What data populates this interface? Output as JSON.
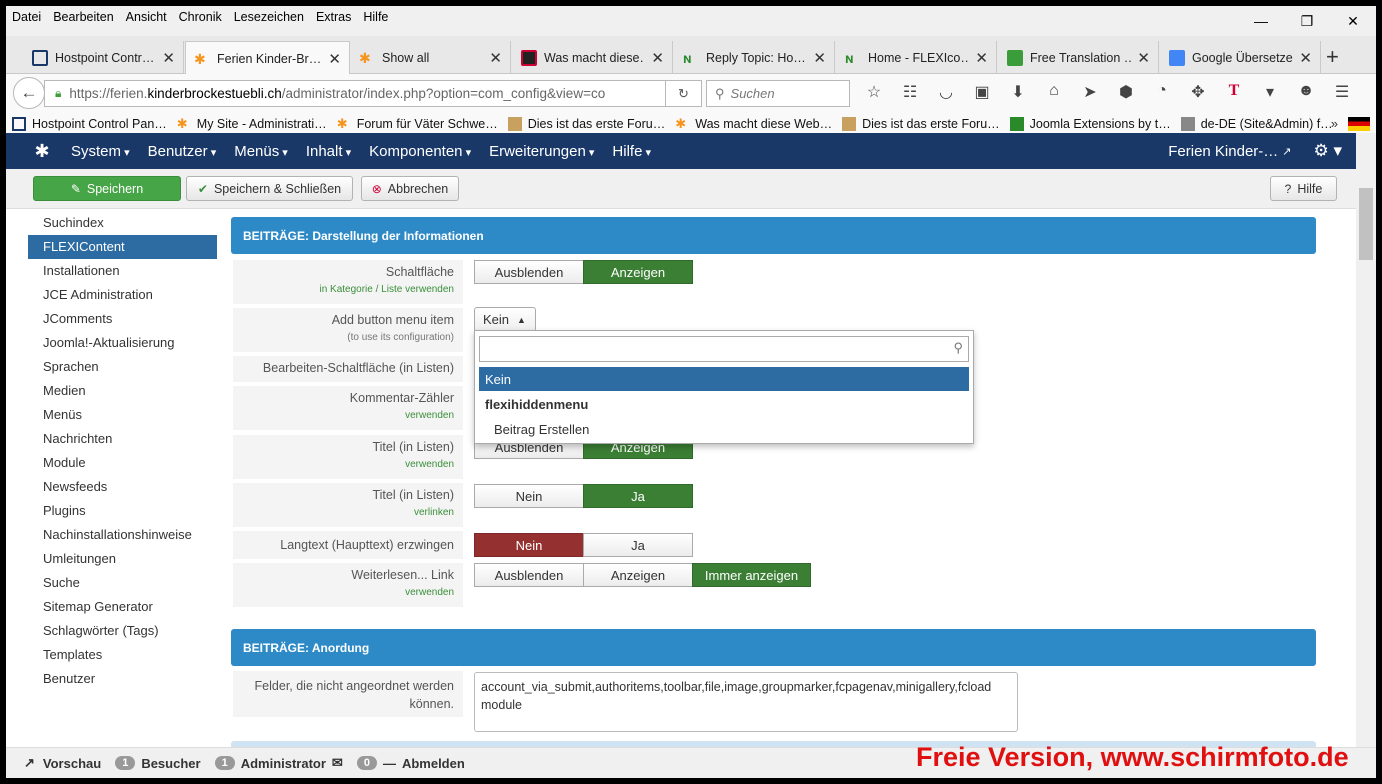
{
  "menubar": [
    "Datei",
    "Bearbeiten",
    "Ansicht",
    "Chronik",
    "Lesezeichen",
    "Extras",
    "Hilfe"
  ],
  "window_controls": {
    "minimize": "—",
    "maximize": "❐",
    "close": "✕"
  },
  "tabs": [
    {
      "label": "Hostpoint Contr…",
      "color": "#1a3867"
    },
    {
      "label": "Ferien Kinder-Br…",
      "color": "#f7941d"
    },
    {
      "label": "Show all",
      "color": "#f7941d"
    },
    {
      "label": "Was macht diese…",
      "color": "#c03"
    },
    {
      "label": "Reply Topic: Ho…",
      "color": "#2a8a2a"
    },
    {
      "label": "Home - FLEXIco…",
      "color": "#2a8a2a"
    },
    {
      "label": "Free Translation …",
      "color": "#3a9d3a"
    },
    {
      "label": "Google Übersetzer",
      "color": "#4285f4"
    }
  ],
  "urlbar": {
    "prefix": "https://ferien.",
    "domain": "kinderbrockestuebli.ch",
    "path": "/administrator/index.php?option=com_config&view=co",
    "search_placeholder": "Suchen"
  },
  "bookmarks": [
    "Hostpoint Control Pan…",
    "My Site - Administrati…",
    "Forum für Väter Schwe…",
    "Dies ist das erste Foru…",
    "Was macht diese Web…",
    "Dies ist das erste Foru…",
    "Joomla Extensions by t…",
    "de-DE (Site&Admin) f…"
  ],
  "joomla_nav": {
    "items": [
      "System",
      "Benutzer",
      "Menüs",
      "Inhalt",
      "Komponenten",
      "Erweiterungen",
      "Hilfe"
    ],
    "site": "Ferien Kinder-…"
  },
  "toolbar": {
    "save": "Speichern",
    "save_close": "Speichern & Schließen",
    "cancel": "Abbrechen",
    "help": "Hilfe"
  },
  "sidebar": [
    "Suchindex",
    "FLEXIContent",
    "Installationen",
    "JCE Administration",
    "JComments",
    "Joomla!-Aktualisierung",
    "Sprachen",
    "Medien",
    "Menüs",
    "Nachrichten",
    "Module",
    "Newsfeeds",
    "Plugins",
    "Nachinstallationshinweise",
    "Umleitungen",
    "Suche",
    "Sitemap Generator",
    "Schlagwörter (Tags)",
    "Templates",
    "Benutzer"
  ],
  "section1": {
    "title": "BEITRÄGE: Darstellung der Informationen",
    "rows": [
      {
        "label": "Schaltfläche",
        "sub": "in Kategorie / Liste verwenden",
        "options": [
          "Ausblenden",
          "Anzeigen"
        ]
      },
      {
        "label": "Add button menu item",
        "sub": "(to use its configuration)",
        "select": "Kein"
      },
      {
        "label": "Bearbeiten-Schaltfläche (in Listen)"
      },
      {
        "label": "Kommentar-Zähler",
        "sub": "verwenden"
      },
      {
        "label": "Titel (in Listen)",
        "sub": "verwenden",
        "options": [
          "Ausblenden",
          "Anzeigen"
        ]
      },
      {
        "label": "Titel (in Listen)",
        "sub": "verlinken",
        "options": [
          "Nein",
          "Ja"
        ]
      },
      {
        "label": "Langtext (Haupttext) erzwingen",
        "options": [
          "Nein",
          "Ja"
        ]
      },
      {
        "label": "Weiterlesen... Link",
        "sub": "verwenden",
        "options": [
          "Ausblenden",
          "Anzeigen",
          "Immer anzeigen"
        ]
      }
    ]
  },
  "dropdown": {
    "options": [
      "Kein",
      "flexihiddenmenu",
      "Beitrag Erstellen"
    ]
  },
  "section2": {
    "title": "BEITRÄGE: Anordung",
    "row_label": "Felder, die nicht angeordnet werden können.",
    "textarea": "account_via_submit,authoritems,toolbar,file,image,groupmarker,fcpagenav,minigallery,fcload module"
  },
  "status": {
    "preview": "Vorschau",
    "visitors_count": "1",
    "visitors": "Besucher",
    "admin_count": "1",
    "admin": "Administrator",
    "msg_count": "0",
    "logout": "Abmelden"
  },
  "watermark": "Freie Version, www.schirmfoto.de"
}
